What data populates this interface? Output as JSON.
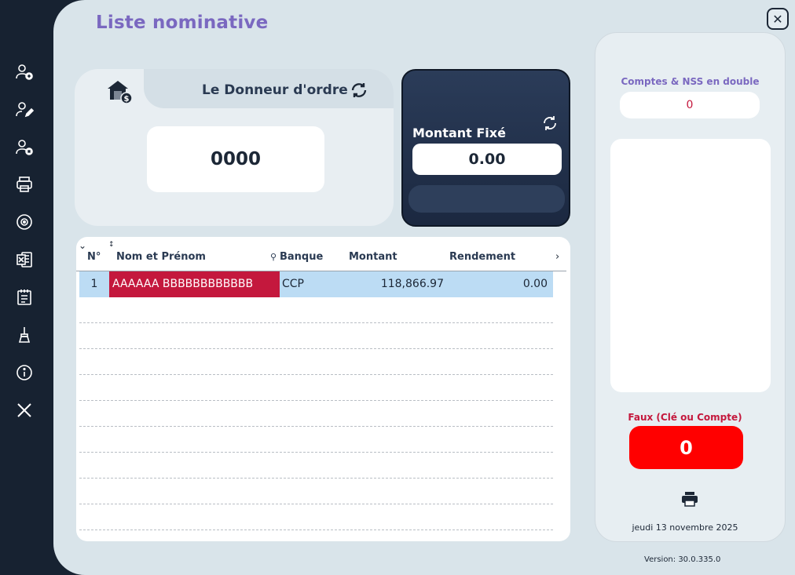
{
  "page_title": "Liste nominative",
  "close_label": "✕",
  "sidebar": {
    "items": [
      {
        "name": "add-user",
        "icon": "user-plus-icon"
      },
      {
        "name": "edit-user",
        "icon": "user-edit-icon"
      },
      {
        "name": "delete-user",
        "icon": "user-remove-icon"
      },
      {
        "name": "print",
        "icon": "printer-icon"
      },
      {
        "name": "disc",
        "icon": "disc-icon"
      },
      {
        "name": "excel",
        "icon": "excel-icon"
      },
      {
        "name": "notepad",
        "icon": "notepad-icon"
      },
      {
        "name": "clean",
        "icon": "broom-icon"
      },
      {
        "name": "info",
        "icon": "info-icon"
      },
      {
        "name": "exit",
        "icon": "close-icon"
      }
    ]
  },
  "donneur": {
    "label": "Le Donneur d'ordre",
    "value": "0000"
  },
  "montant": {
    "label": "Montant Fixé",
    "value": "0.00"
  },
  "grid": {
    "columns": {
      "num": "N°",
      "name": "Nom et Prénom",
      "bank": "Banque",
      "amount": "Montant",
      "yield": "Rendement"
    },
    "rows": [
      {
        "num": "1",
        "name": "AAAAAA BBBBBBBBBBBB",
        "bank": "CCP",
        "amount": "118,866.97",
        "yield": "0.00"
      }
    ]
  },
  "right_panel": {
    "dup_label": "Comptes & NSS en double",
    "dup_count": "0",
    "error_label": "Faux (Clé ou Compte)",
    "error_count": "0",
    "date": "jeudi 13 novembre 2025"
  },
  "version": "Version: 30.0.335.0",
  "colors": {
    "sidebar": "#172231",
    "panel": "#d9e4ea",
    "title": "#7a68c0",
    "accent_red": "#c4183d",
    "error_red": "#ff0000",
    "selected_row": "#bcdcf4"
  }
}
